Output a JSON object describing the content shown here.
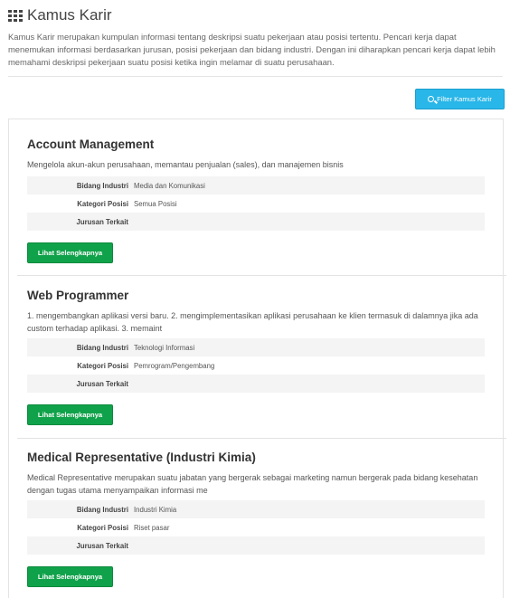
{
  "header": {
    "icon": "grid-icon",
    "title": "Kamus Karir",
    "description": "Kamus Karir merupakan kumpulan informasi tentang deskripsi suatu pekerjaan atau posisi tertentu. Pencari kerja dapat menemukan informasi berdasarkan jurusan, posisi pekerjaan dan bidang industri. Dengan ini diharapkan pencari kerja dapat lebih memahami deskripsi pekerjaan suatu posisi ketika ingin melamar di suatu perusahaan."
  },
  "filter_button": {
    "icon": "search-icon",
    "label": "Filter Kamus Karir"
  },
  "labels": {
    "bidang": "Bidang Industri",
    "kategori": "Kategori Posisi",
    "jurusan": "Jurusan Terkait",
    "more": "Lihat Selengkapnya"
  },
  "careers": [
    {
      "title": "Account Management",
      "description": "Mengelola akun-akun perusahaan, memantau penjualan (sales), dan manajemen bisnis",
      "bidang": "Media dan Komunikasi",
      "kategori": "Semua Posisi",
      "jurusan": ""
    },
    {
      "title": "Web Programmer",
      "description": "1. mengembangkan aplikasi versi baru. 2. mengimplementasikan aplikasi perusahaan ke klien termasuk di dalamnya jika ada custom terhadap aplikasi. 3. memaint",
      "bidang": "Teknologi Informasi",
      "kategori": "Pemrogram/Pengembang",
      "jurusan": ""
    },
    {
      "title": "Medical Representative (Industri Kimia)",
      "description": "Medical Representative merupakan suatu jabatan yang bergerak sebagai marketing namun bergerak pada bidang kesehatan dengan tugas utama menyampaikan informasi me",
      "bidang": "Industri Kimia",
      "kategori": "Riset pasar",
      "jurusan": ""
    }
  ]
}
